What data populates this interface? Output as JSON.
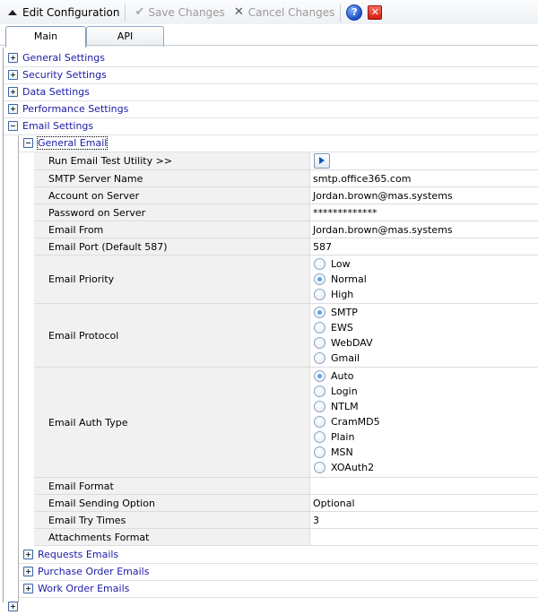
{
  "toolbar": {
    "edit_config_label": "Edit Configuration",
    "save_label": "Save Changes",
    "cancel_label": "Cancel Changes",
    "help_icon": "help-icon",
    "close_icon": "close-icon"
  },
  "tabs": [
    {
      "label": "Main",
      "active": true
    },
    {
      "label": "API",
      "active": false
    }
  ],
  "tree": {
    "top_nodes": [
      {
        "label": "General Settings",
        "expanded": false
      },
      {
        "label": "Security Settings",
        "expanded": false
      },
      {
        "label": "Data Settings",
        "expanded": false
      },
      {
        "label": "Performance Settings",
        "expanded": false
      },
      {
        "label": "Email Settings",
        "expanded": true
      }
    ],
    "general_email": {
      "label": "General Email",
      "expanded": true,
      "properties": {
        "run_test": {
          "name": "Run Email Test Utility >>"
        },
        "smtp_server": {
          "name": "SMTP Server Name",
          "value": "smtp.office365.com"
        },
        "account": {
          "name": "Account on Server",
          "value": "Jordan.brown@mas.systems"
        },
        "password": {
          "name": "Password on Server",
          "value": "*************"
        },
        "email_from": {
          "name": "Email From",
          "value": "Jordan.brown@mas.systems"
        },
        "email_port": {
          "name": "Email Port (Default 587)",
          "value": "587"
        },
        "priority": {
          "name": "Email Priority",
          "options": [
            "Low",
            "Normal",
            "High"
          ],
          "selected": "Normal"
        },
        "protocol": {
          "name": "Email Protocol",
          "options": [
            "SMTP",
            "EWS",
            "WebDAV",
            "Gmail"
          ],
          "selected": "SMTP"
        },
        "auth_type": {
          "name": "Email Auth Type",
          "options": [
            "Auto",
            "Login",
            "NTLM",
            "CramMD5",
            "Plain",
            "MSN",
            "XOAuth2"
          ],
          "selected": "Auto"
        },
        "format": {
          "name": "Email Format",
          "value": ""
        },
        "sending_option": {
          "name": "Email Sending Option",
          "value": "Optional"
        },
        "try_times": {
          "name": "Email Try Times",
          "value": "3"
        },
        "attachments_format": {
          "name": "Attachments Format",
          "value": ""
        }
      }
    },
    "email_subnodes": [
      {
        "label": "Requests Emails",
        "expanded": false
      },
      {
        "label": "Purchase Order Emails",
        "expanded": false
      },
      {
        "label": "Work Order Emails",
        "expanded": false
      }
    ]
  }
}
